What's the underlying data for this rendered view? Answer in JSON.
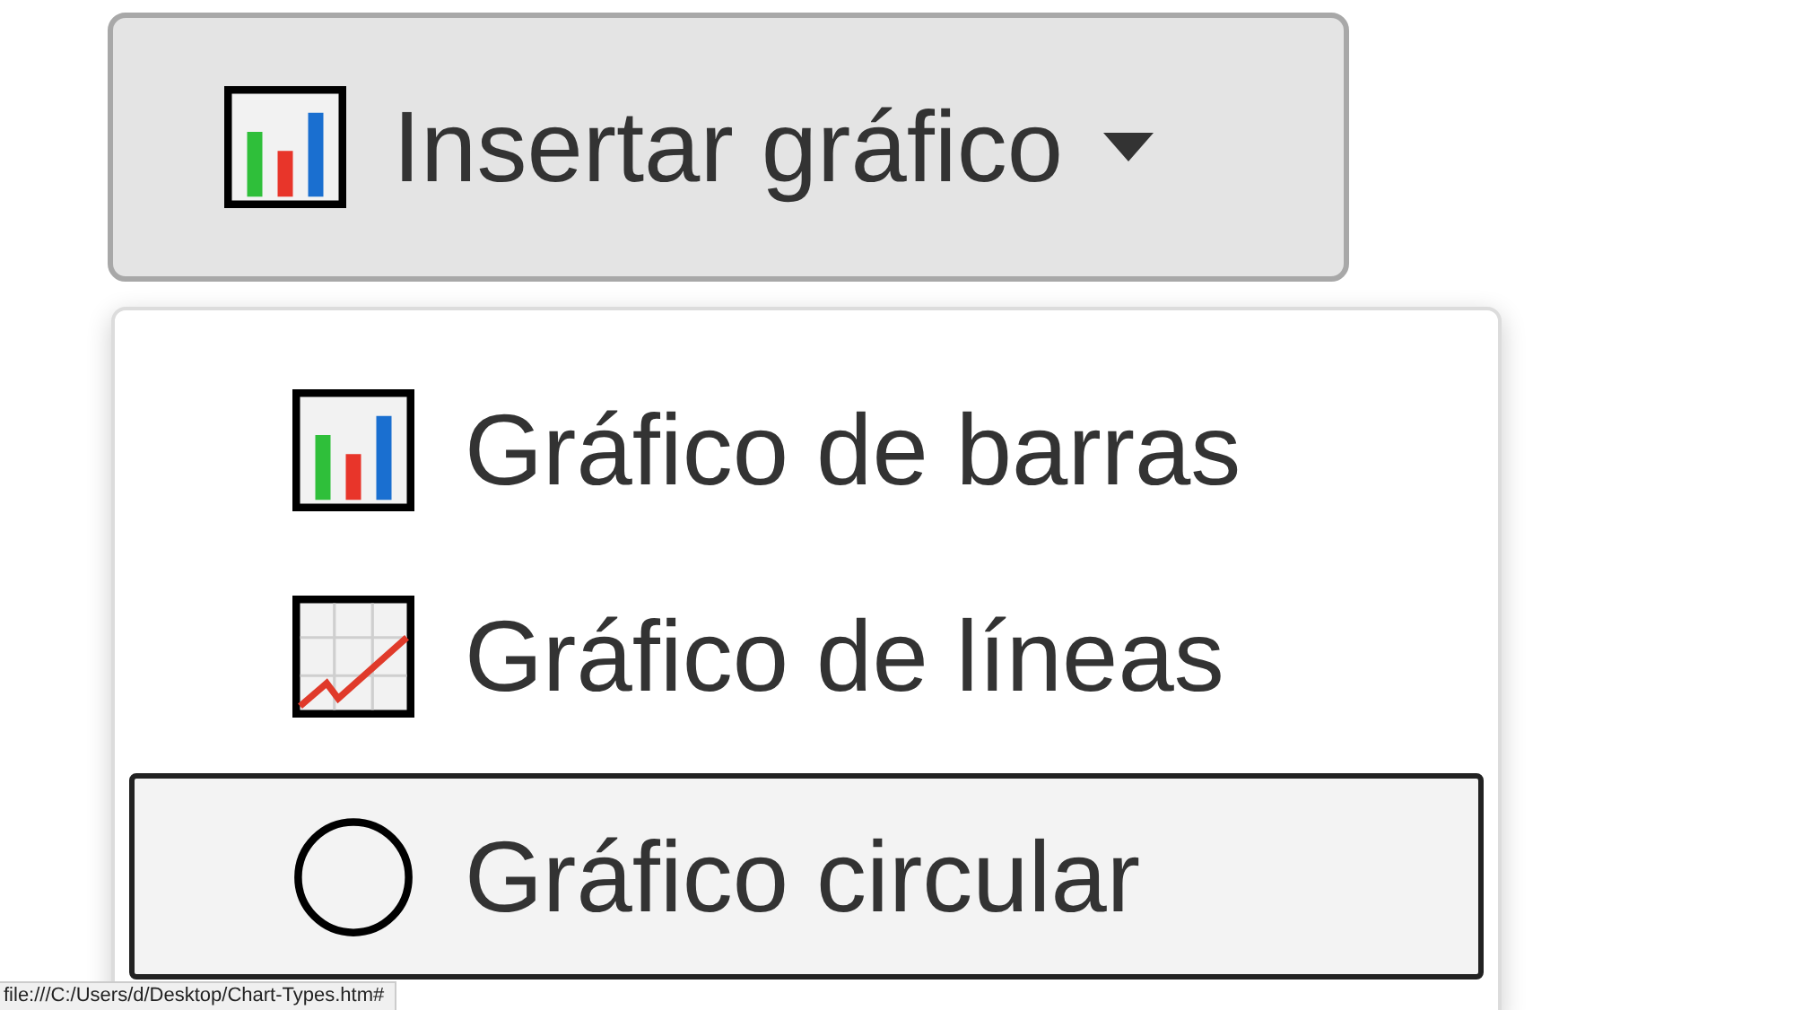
{
  "button": {
    "label": "Insertar gráfico",
    "expanded": true
  },
  "menu": {
    "items": [
      {
        "kind": "bar",
        "label": "Gráfico de barras",
        "selected": false
      },
      {
        "kind": "line",
        "label": "Gráfico de líneas",
        "selected": false
      },
      {
        "kind": "pie",
        "label": "Gráfico circular",
        "selected": true
      }
    ]
  },
  "status_bar": {
    "url": "file:///C:/Users/d/Desktop/Chart-Types.htm#"
  }
}
